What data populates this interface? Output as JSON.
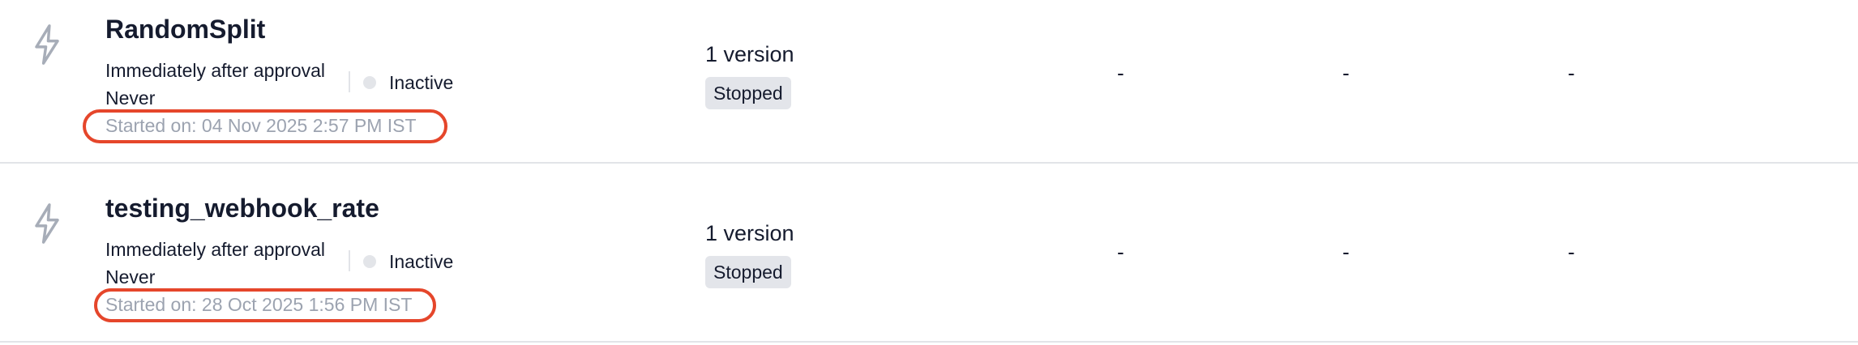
{
  "rows": [
    {
      "icon": "lightning-bolt-icon",
      "name": "RandomSplit",
      "schedule_line1": "Immediately after approval",
      "schedule_line2": "Never",
      "status": "Inactive",
      "started": "Started on: 04 Nov 2025 2:57 PM IST",
      "versions": "1 version",
      "badge": "Stopped",
      "col_a": "-",
      "col_b": "-",
      "col_c": "-"
    },
    {
      "icon": "lightning-bolt-icon",
      "name": "testing_webhook_rate",
      "schedule_line1": "Immediately after approval",
      "schedule_line2": "Never",
      "status": "Inactive",
      "started": "Started on: 28 Oct 2025 1:56 PM IST",
      "versions": "1 version",
      "badge": "Stopped",
      "col_a": "-",
      "col_b": "-",
      "col_c": "-"
    }
  ],
  "colors": {
    "highlight": "#e5462b",
    "muted_text": "#9ca3b0",
    "status_dot": "#e3e5e9",
    "badge_bg": "#e3e5ea"
  }
}
